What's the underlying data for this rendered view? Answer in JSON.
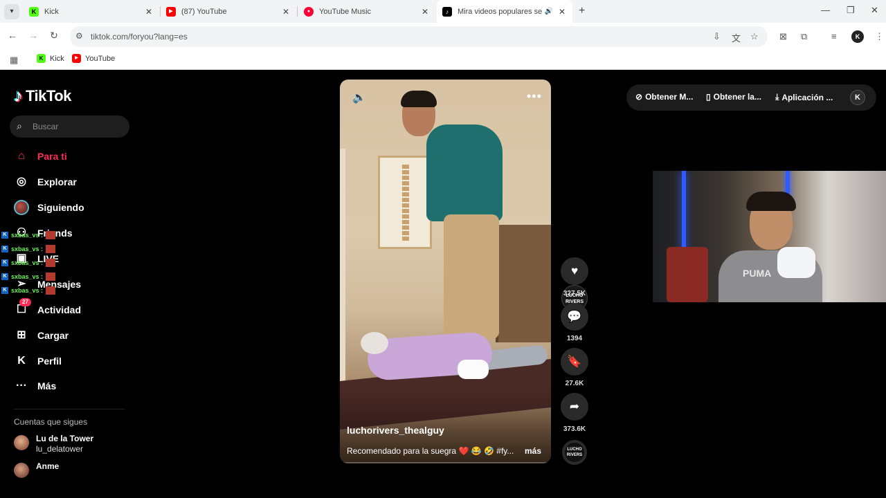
{
  "browser": {
    "tabs": [
      {
        "title": "Kick",
        "favicon": "kick-icon"
      },
      {
        "title": "(87) YouTube",
        "favicon": "youtube-icon"
      },
      {
        "title": "YouTube Music",
        "favicon": "youtube-music-icon"
      },
      {
        "title": "Mira videos populares selec",
        "favicon": "tiktok-icon",
        "active": true
      }
    ],
    "url": "tiktok.com/foryou?lang=es",
    "bookmarks": [
      {
        "label": "Kick",
        "favicon": "kick-icon"
      },
      {
        "label": "YouTube",
        "favicon": "youtube-icon"
      }
    ]
  },
  "sidebar": {
    "logo_text": "TikTok",
    "search_placeholder": "Buscar",
    "nav": [
      {
        "label": "Para ti",
        "icon": "home-icon",
        "active": true
      },
      {
        "label": "Explorar",
        "icon": "compass-icon"
      },
      {
        "label": "Siguiendo",
        "icon": "following-avatar-icon"
      },
      {
        "label": "Friends",
        "icon": "friends-icon"
      },
      {
        "label": "LIVE",
        "icon": "live-icon"
      },
      {
        "label": "Mensajes",
        "icon": "paper-plane-icon"
      },
      {
        "label": "Actividad",
        "icon": "activity-icon",
        "badge": "27"
      },
      {
        "label": "Cargar",
        "icon": "upload-icon"
      },
      {
        "label": "Perfil",
        "icon": "profile-icon"
      },
      {
        "label": "Más",
        "icon": "more-icon"
      }
    ],
    "following_header": "Cuentas que sigues",
    "following": [
      {
        "name": "Lu de la Tower",
        "handle": "lu_delatower"
      },
      {
        "name": "Anme",
        "handle": ""
      }
    ]
  },
  "chat_overlay": {
    "lines": [
      "sxbas_vs :",
      "sxbas_vs :",
      "sxbas_vs :",
      "sxbas_vs :",
      "sxbas_vs :"
    ]
  },
  "video": {
    "author": "luchorivers_thealguy",
    "caption": "Recomendado para la suegra ❤️ 😂 🤣 #fy...",
    "more_label": "más",
    "progress": 0.02,
    "creator_avatar_text": "LUCHO RIVERS",
    "music_disc_text": "LUCHO RIVERS"
  },
  "actions": {
    "likes": "327.5K",
    "comments": "1394",
    "saves": "27.6K",
    "shares": "373.6K"
  },
  "topbar": {
    "items": [
      "Obtener M...",
      "Obtener la...",
      "Aplicación ..."
    ],
    "profile_initial": "K"
  },
  "webcam": {
    "shirt_text": "PUMA"
  }
}
